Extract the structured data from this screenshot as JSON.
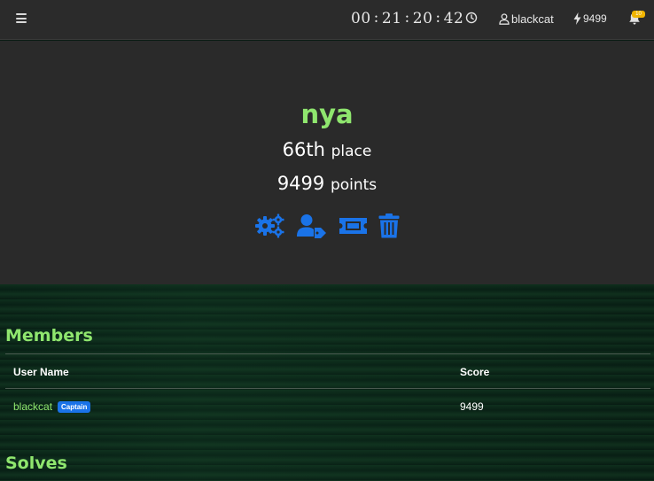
{
  "navbar": {
    "timer": {
      "h": "00",
      "m": "21",
      "s": "20",
      "ms": "42"
    },
    "username": "blackcat",
    "points": "9499",
    "notification_badge": "10"
  },
  "team": {
    "name": "nya",
    "place_value": "66th",
    "place_label": "place",
    "points_value": "9499",
    "points_label": "points"
  },
  "members": {
    "title": "Members",
    "columns": [
      "User Name",
      "Score"
    ],
    "rows": [
      {
        "name": "blackcat",
        "badge": "Captain",
        "score": "9499"
      }
    ]
  },
  "solves": {
    "title": "Solves"
  },
  "colors": {
    "accent_green": "#8fe66e",
    "icon_blue": "#1a73e8",
    "badge_yellow": "#f0b400"
  }
}
